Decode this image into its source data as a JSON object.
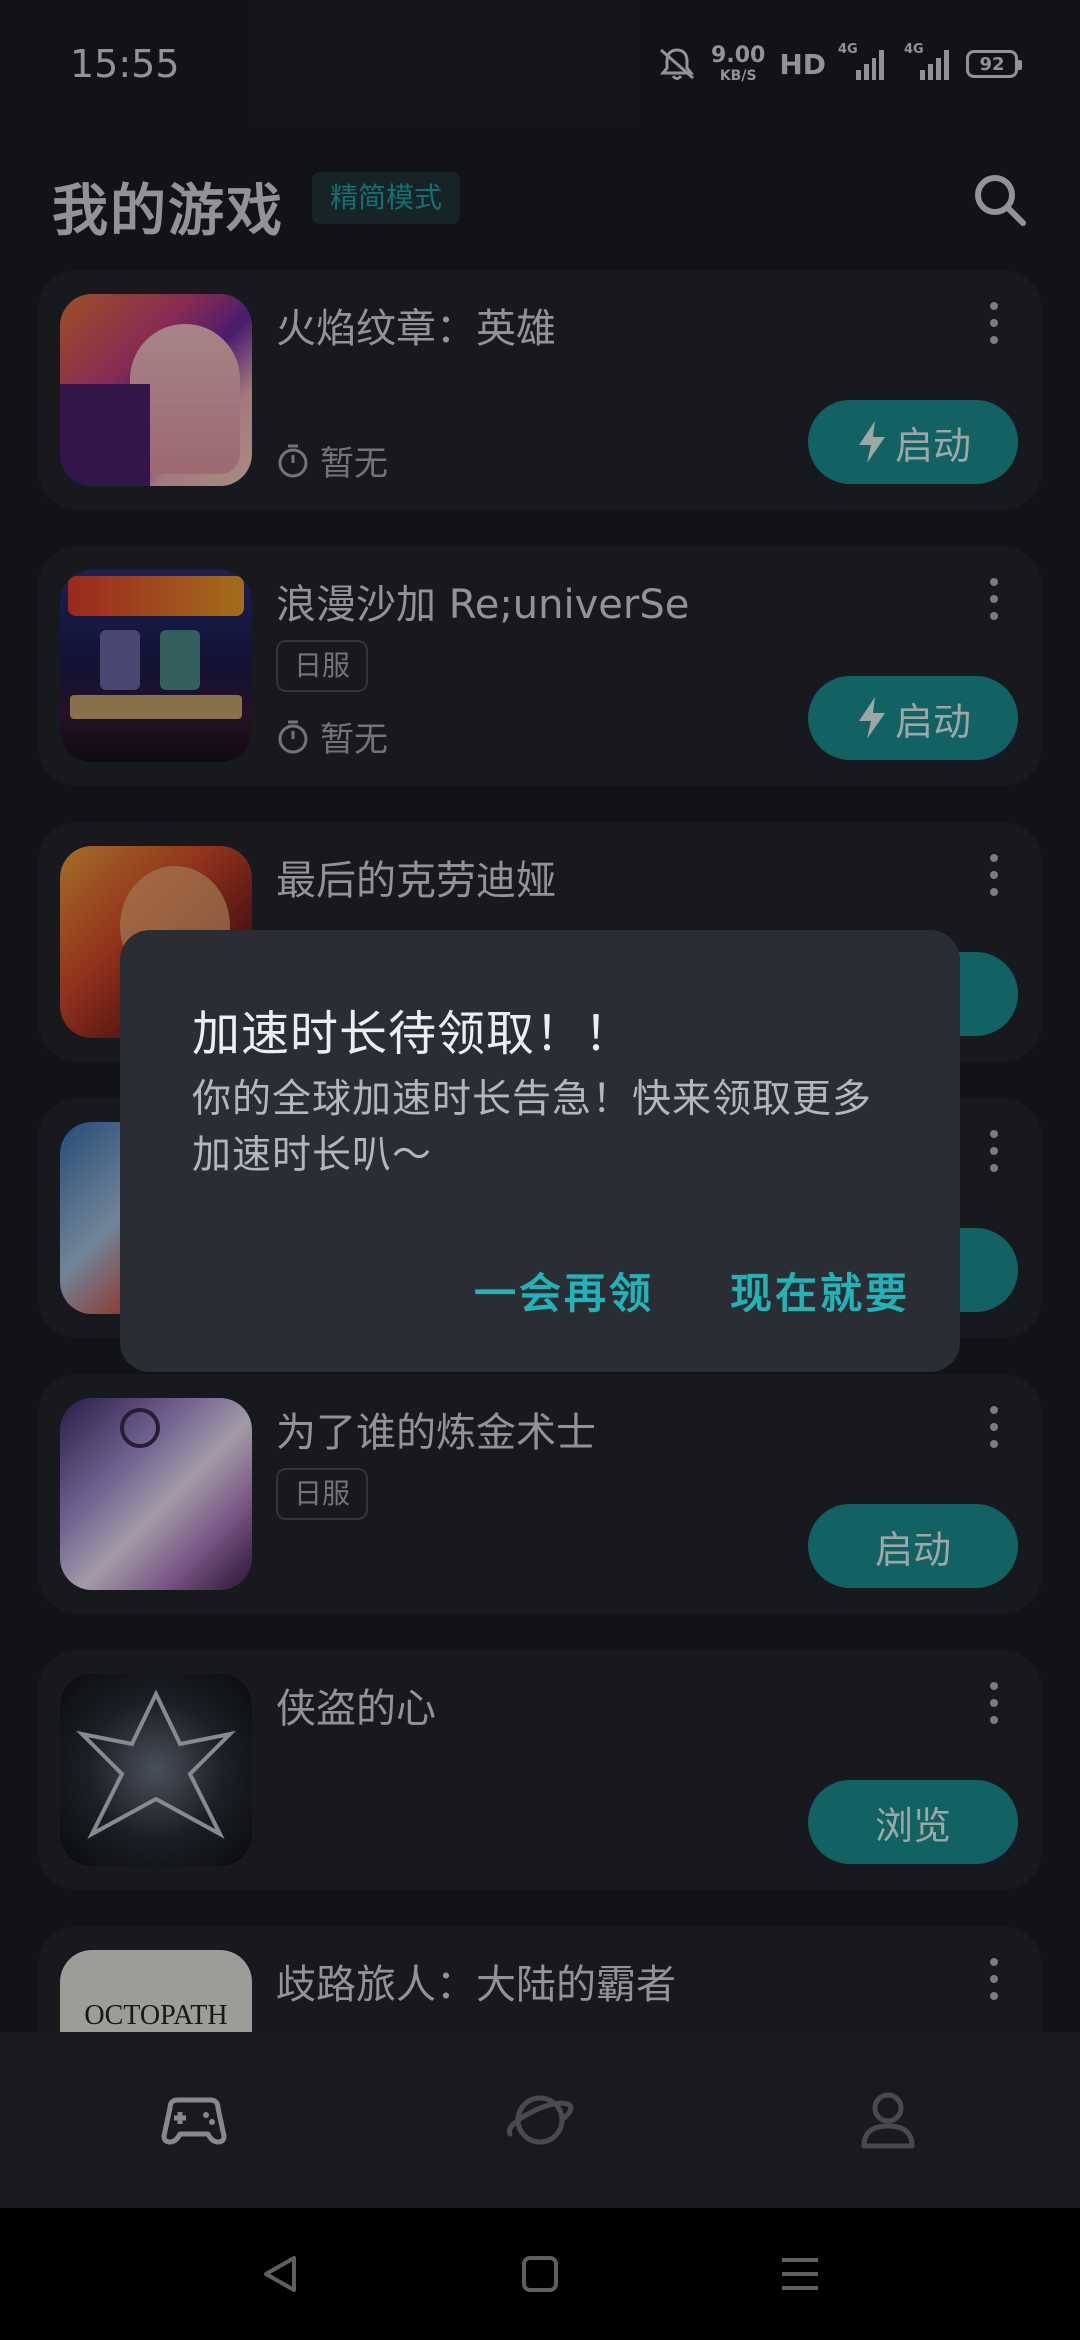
{
  "status_bar": {
    "time": "15:55",
    "net_speed_value": "9.00",
    "net_speed_unit": "KB/S",
    "hd": "HD",
    "sim1": "4G",
    "sim2": "4G",
    "battery": "92"
  },
  "header": {
    "title": "我的游戏",
    "mode_badge": "精简模式",
    "search_icon": "search-icon"
  },
  "games": [
    {
      "name": "火焰纹章：英雄",
      "region": "",
      "playtime": "暂无",
      "action": "启动",
      "action_icon": "lightning-icon"
    },
    {
      "name": "浪漫沙加 Re;univerSe",
      "region": "日服",
      "playtime": "暂无",
      "action": "启动",
      "action_icon": "lightning-icon"
    },
    {
      "name": "最后的克劳迪娅",
      "region": "",
      "playtime": "",
      "action": "动",
      "action_icon": ""
    },
    {
      "name": "",
      "region": "",
      "playtime": "",
      "action": "",
      "action_icon": ""
    },
    {
      "name": "为了谁的炼金术士",
      "region": "日服",
      "playtime": "",
      "action": "启动",
      "action_icon": ""
    },
    {
      "name": "侠盗的心",
      "region": "",
      "playtime": "",
      "action": "浏览",
      "action_icon": ""
    },
    {
      "name": "歧路旅人：大陆的霸者",
      "region": "",
      "playtime": "",
      "action": "",
      "action_icon": "",
      "cover_text": "OCTOPATH"
    }
  ],
  "bottom_nav": {
    "items": [
      "gamepad-icon",
      "planet-icon",
      "profile-icon"
    ],
    "active_color": "#c9cbd0"
  },
  "dialog": {
    "title": "加速时长待领取！！",
    "message": "你的全球加速时长告急！快来领取更多加速时长叭～",
    "negative": "一会再领",
    "positive": "现在就要"
  },
  "colors": {
    "background": "#1b1d22",
    "card": "#22252b",
    "accent": "#1b8f93",
    "dialog_button": "#21b3b8"
  }
}
